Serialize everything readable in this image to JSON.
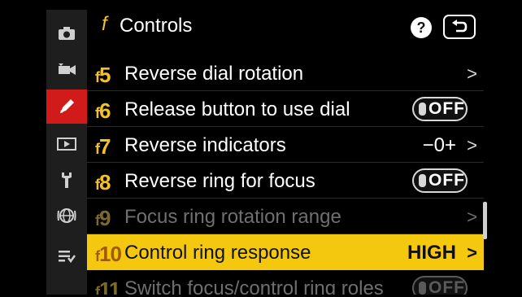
{
  "header": {
    "letter": "f",
    "title": "Controls",
    "help_label": "?"
  },
  "sidebar": {
    "items": [
      {
        "icon": "camera-icon"
      },
      {
        "icon": "movie-icon"
      },
      {
        "icon": "pencil-icon",
        "active": true
      },
      {
        "icon": "playback-icon"
      },
      {
        "icon": "wrench-icon"
      },
      {
        "icon": "network-icon"
      },
      {
        "icon": "my-menu-icon"
      }
    ]
  },
  "menu": {
    "rows": [
      {
        "code": "f",
        "num": "5",
        "label": "Reverse dial rotation",
        "value": "",
        "state": "normal"
      },
      {
        "code": "f",
        "num": "6",
        "label": "Release button to use dial",
        "toggle": "OFF",
        "state": "normal"
      },
      {
        "code": "f",
        "num": "7",
        "label": "Reverse indicators",
        "value": "−0+",
        "state": "normal"
      },
      {
        "code": "f",
        "num": "8",
        "label": "Reverse ring for focus",
        "toggle": "OFF",
        "state": "normal"
      },
      {
        "code": "f",
        "num": "9",
        "label": "Focus ring rotation range",
        "value": "",
        "state": "dim"
      },
      {
        "code": "f",
        "num": "10",
        "label": "Control ring response",
        "value": "HIGH",
        "state": "selected"
      },
      {
        "code": "f",
        "num": "11",
        "label": "Switch focus/control ring roles",
        "toggle": "OFF",
        "state": "dim"
      }
    ],
    "chevron": ">"
  },
  "colors": {
    "accent": "#f4c80f",
    "active_tab": "#d11a1a",
    "code": "#f3c22a"
  }
}
